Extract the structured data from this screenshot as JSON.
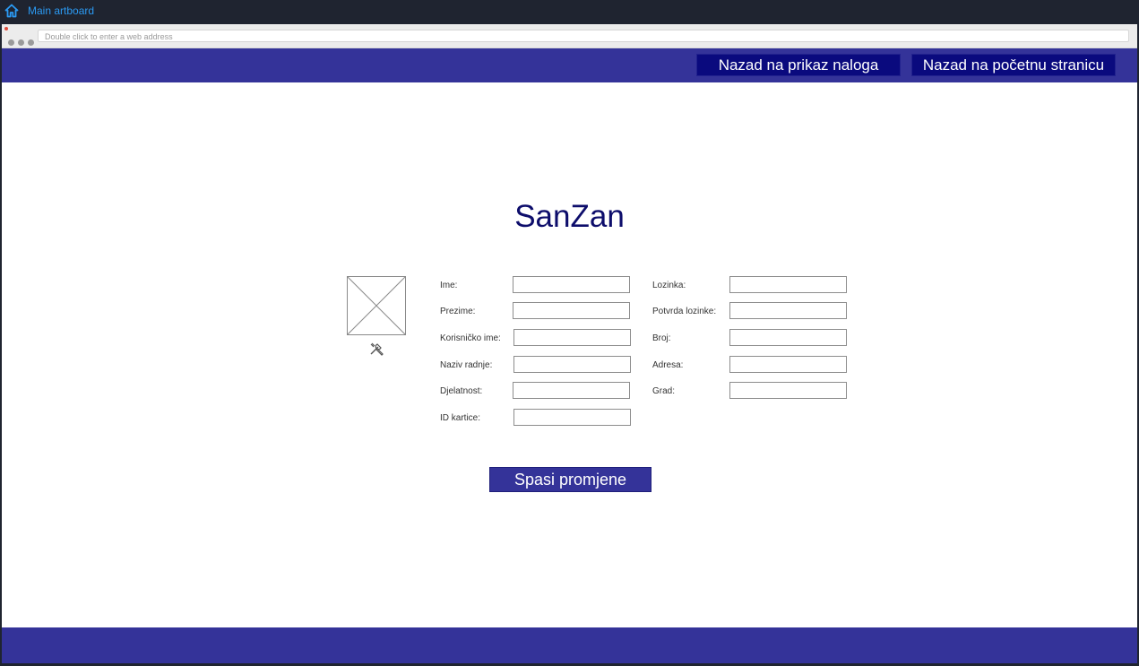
{
  "topbar": {
    "title": "Main artboard",
    "home_icon": "home-icon",
    "accent": "#2b9af3"
  },
  "browser": {
    "address_placeholder": "Double click to enter a web address"
  },
  "header": {
    "buttons": [
      {
        "label": "Nazad na prikaz naloga"
      },
      {
        "label": "Nazad na početnu stranicu"
      }
    ]
  },
  "brand": {
    "name": "SanZan"
  },
  "avatar": {
    "icon": "image-placeholder-icon",
    "edit_icon": "tools-icon"
  },
  "form": {
    "left": [
      {
        "label": "Ime:",
        "value": ""
      },
      {
        "label": "Prezime:",
        "value": ""
      },
      {
        "label": "Korisničko ime:",
        "value": ""
      },
      {
        "label": "Naziv radnje:",
        "value": ""
      },
      {
        "label": "Djelatnost:",
        "value": ""
      },
      {
        "label": "ID kartice:",
        "value": ""
      }
    ],
    "right": [
      {
        "label": "Lozinka:",
        "value": ""
      },
      {
        "label": "Potvrda lozinke:",
        "value": ""
      },
      {
        "label": "Broj:",
        "value": ""
      },
      {
        "label": "Adresa:",
        "value": ""
      },
      {
        "label": "Grad:",
        "value": ""
      }
    ],
    "save_label": "Spasi promjene"
  },
  "colors": {
    "band": "#343399",
    "nav_button": "#0a0a7e",
    "brand_text": "#0d0d6b"
  }
}
